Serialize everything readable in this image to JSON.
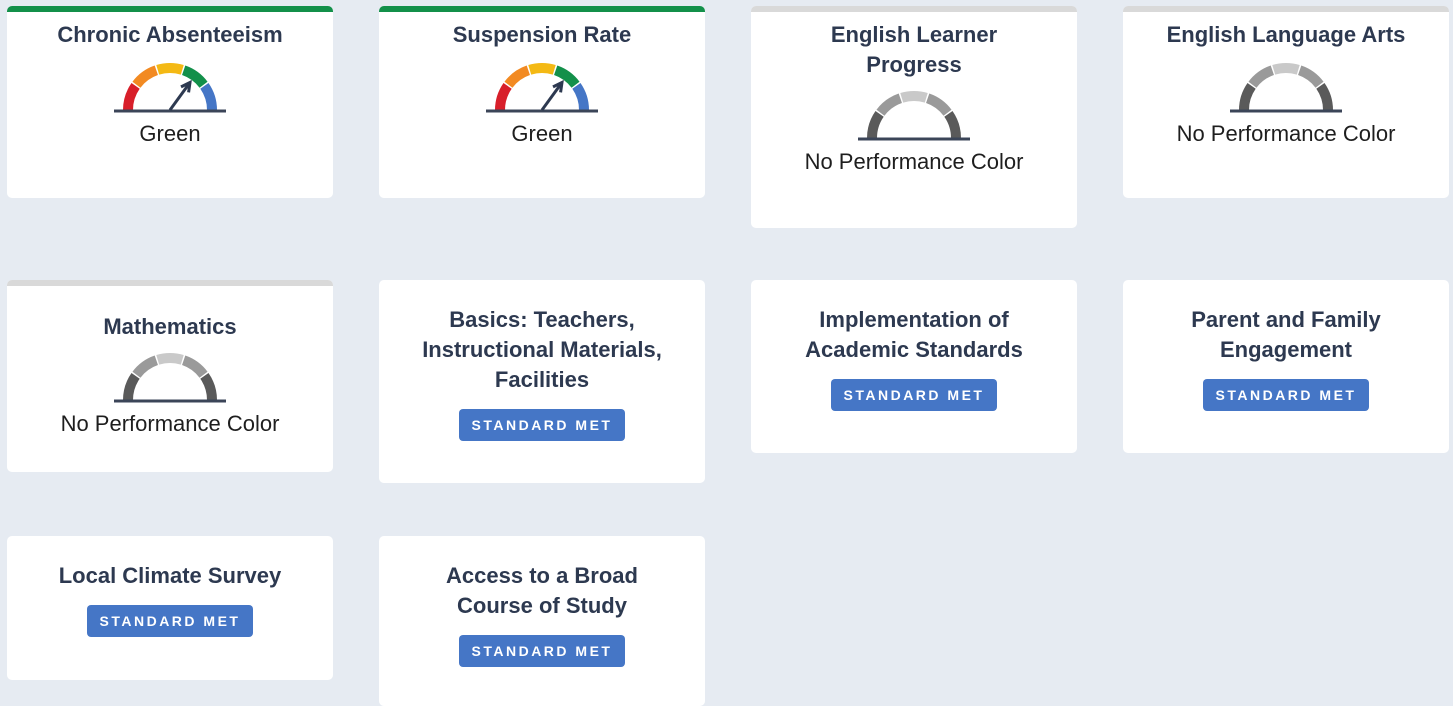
{
  "colors": {
    "red": "#d81f2a",
    "orange": "#f28a22",
    "yellow": "#f4b914",
    "green": "#13904a",
    "blue": "#4576c6",
    "grey_dark": "#5a5a5a",
    "grey_mid": "#9a9a9a",
    "grey_light": "#c9c9c9",
    "badge": "#4576c6"
  },
  "cards": [
    {
      "title": "Chronic Absenteeism",
      "status": "Green"
    },
    {
      "title": "Suspension Rate",
      "status": "Green"
    },
    {
      "title": "English Learner Progress",
      "status": "No Performance Color"
    },
    {
      "title": "English Language Arts",
      "status": "No Performance Color"
    },
    {
      "title": "Mathematics",
      "status": "No Performance Color"
    },
    {
      "title": "Basics: Teachers, Instructional Materials, Facilities",
      "badge": "STANDARD MET"
    },
    {
      "title": "Implementation of Academic Standards",
      "badge": "STANDARD MET"
    },
    {
      "title": "Parent and Family Engagement",
      "badge": "STANDARD MET"
    },
    {
      "title": "Local Climate Survey",
      "badge": "STANDARD MET"
    },
    {
      "title": "Access to a Broad Course of Study",
      "badge": "STANDARD MET"
    }
  ]
}
